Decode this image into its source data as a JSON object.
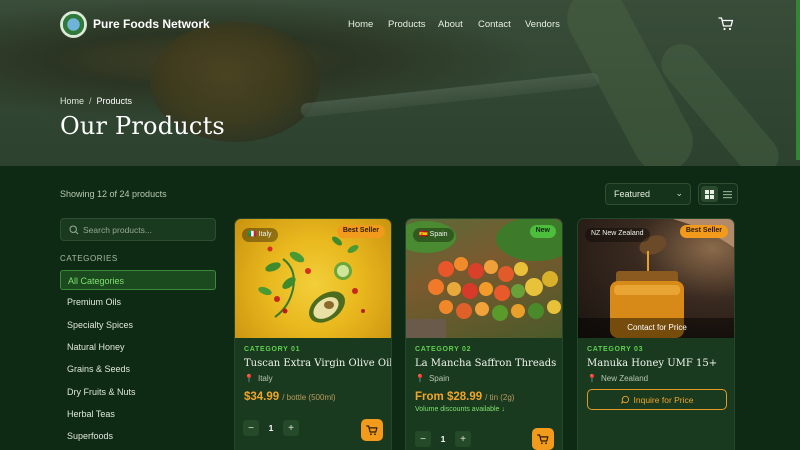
{
  "nav": {
    "brand": "Pure Foods Network",
    "links": [
      "Home",
      "Products",
      "About",
      "Contact",
      "Vendors"
    ]
  },
  "hero": {
    "breadcrumb": {
      "home": "Home",
      "separator": "/",
      "current": "Products"
    },
    "title": "Our Products"
  },
  "toolbar": {
    "showing": "Showing 12 of 24 products",
    "sort_selected": "Featured",
    "view_active": "grid"
  },
  "sidebar": {
    "search_placeholder": "Search products...",
    "categories_heading": "CATEGORIES",
    "categories": [
      "All Categories",
      "Premium Oils",
      "Specialty Spices",
      "Natural Honey",
      "Grains & Seeds",
      "Dry Fruits & Nuts",
      "Herbal Teas",
      "Superfoods"
    ],
    "active_category": "All Categories"
  },
  "products": [
    {
      "origin_chip": "Italy",
      "badge": "Best Seller",
      "category": "CATEGORY 01",
      "name": "Tuscan Extra Virgin Olive Oil",
      "origin": "Italy",
      "price": "$34.99",
      "unit": "/ bottle (500ml)",
      "qty": "1"
    },
    {
      "origin_chip": "Spain",
      "badge": "New",
      "category": "CATEGORY 02",
      "name": "La Mancha Saffron Threads",
      "origin": "Spain",
      "price": "From $28.99",
      "unit": "/ tin (2g)",
      "discount": "Volume discounts available ↓",
      "qty": "1"
    },
    {
      "origin_chip_code": "NZ",
      "origin_chip": "New Zealand",
      "badge": "Best Seller",
      "overlay": "Contact for Price",
      "category": "CATEGORY 03",
      "name": "Manuka Honey UMF 15+",
      "origin": "New Zealand",
      "cta": "Inquire for Price"
    }
  ],
  "colors": {
    "accent_green": "#5fd04f",
    "accent_orange": "#f29a1b",
    "background": "#0f2a14"
  }
}
